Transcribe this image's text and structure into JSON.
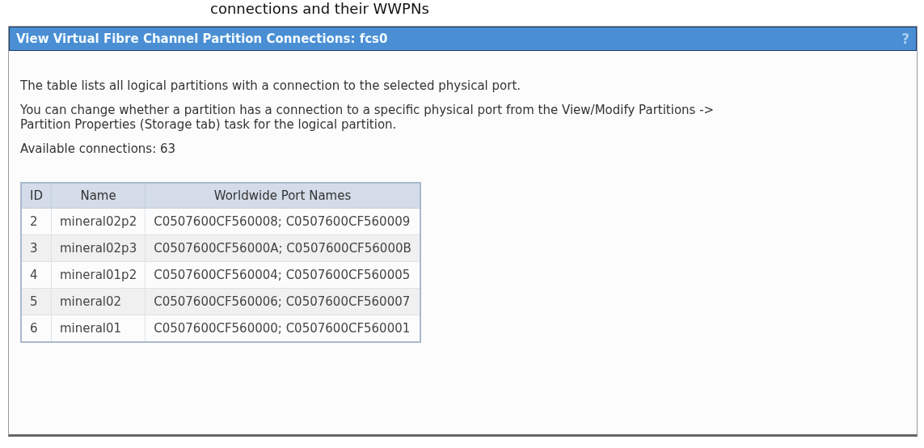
{
  "page_heading": "connections and their WWPNs",
  "dialog": {
    "title": "View Virtual Fibre Channel Partition Connections: fcs0",
    "help": "?"
  },
  "paragraphs": [
    "The table lists all logical partitions with a connection to the selected physical port.",
    "You can change whether a partition has a connection to a specific physical port from the View/Modify Partitions -> Partition Properties (Storage tab) task for the logical partition.",
    "Available connections: 63"
  ],
  "table": {
    "columns": [
      "ID",
      "Name",
      "Worldwide Port Names"
    ],
    "rows": [
      [
        "2",
        "mineral02p2",
        "C0507600CF560008; C0507600CF560009"
      ],
      [
        "3",
        "mineral02p3",
        "C0507600CF56000A; C0507600CF56000B"
      ],
      [
        "4",
        "mineral01p2",
        "C0507600CF560004; C0507600CF560005"
      ],
      [
        "5",
        "mineral02",
        "C0507600CF560006; C0507600CF560007"
      ],
      [
        "6",
        "mineral01",
        "C0507600CF560000; C0507600CF560001"
      ]
    ]
  }
}
